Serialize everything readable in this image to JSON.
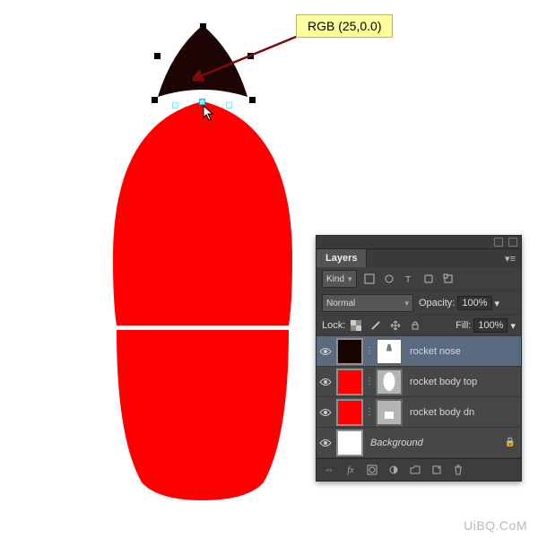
{
  "callout": {
    "text": "RGB (25,0.0)"
  },
  "panel": {
    "title": "Layers",
    "filterLabel": "Kind",
    "blendMode": "Normal",
    "opacityLabel": "Opacity:",
    "opacityValue": "100%",
    "lockLabel": "Lock:",
    "fillLabel": "Fill:",
    "fillValue": "100%"
  },
  "layers": [
    {
      "name": "rocket nose",
      "swatch": "dark",
      "mask": "m1",
      "active": true,
      "italic": false,
      "locked": false
    },
    {
      "name": "rocket body top",
      "swatch": "red",
      "mask": "m2",
      "active": false,
      "italic": false,
      "locked": false
    },
    {
      "name": "rocket body dn",
      "swatch": "red",
      "mask": "m3",
      "active": false,
      "italic": false,
      "locked": false
    },
    {
      "name": "Background",
      "swatch": "white",
      "mask": "",
      "active": false,
      "italic": true,
      "locked": true
    }
  ],
  "watermark": "UiBQ.CoM"
}
